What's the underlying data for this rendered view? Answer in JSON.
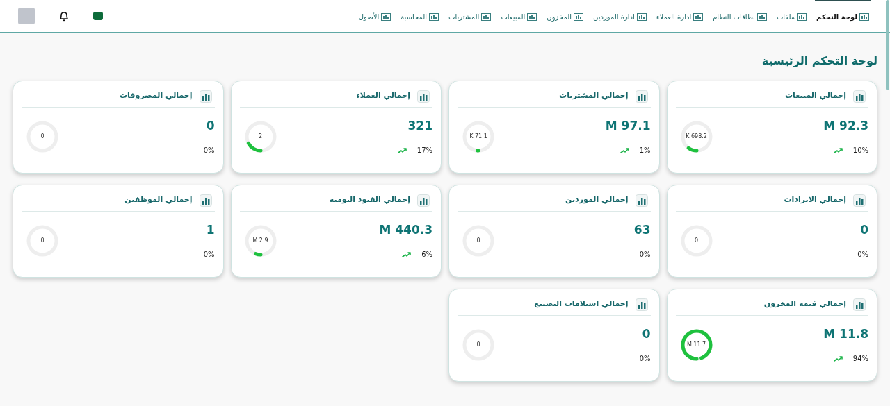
{
  "header": {
    "nav_items": [
      {
        "label": "لوحة التحكم",
        "selected": true
      },
      {
        "label": "ملفات",
        "selected": false
      },
      {
        "label": "بطاقات النظام",
        "selected": false
      },
      {
        "label": "ادارة العملاء",
        "selected": false
      },
      {
        "label": "ادارة الموردين",
        "selected": false
      },
      {
        "label": "المخزون",
        "selected": false
      },
      {
        "label": "المبيعات",
        "selected": false
      },
      {
        "label": "المشتريات",
        "selected": false
      },
      {
        "label": "المحاسبة",
        "selected": false
      },
      {
        "label": "الأصول",
        "selected": false
      }
    ]
  },
  "page_title": "لوحة التحكم الرئيسية",
  "cards": [
    {
      "title": "إجمالي المبيعات",
      "value": "M 92.3",
      "gauge_label": "K 698.2",
      "percent": "10%",
      "trend": true
    },
    {
      "title": "إجمالي المشتريات",
      "value": "M 97.1",
      "gauge_label": "K 71.1",
      "percent": "1%",
      "trend": true
    },
    {
      "title": "إجمالي العملاء",
      "value": "321",
      "gauge_label": "2",
      "percent": "17%",
      "trend": true
    },
    {
      "title": "إجمالي المصروفات",
      "value": "0",
      "gauge_label": "0",
      "percent": "0%",
      "trend": false
    },
    {
      "title": "إجمالي الايرادات",
      "value": "0",
      "gauge_label": "0",
      "percent": "0%",
      "trend": false
    },
    {
      "title": "إجمالي الموردين",
      "value": "63",
      "gauge_label": "0",
      "percent": "0%",
      "trend": false
    },
    {
      "title": "إجمالي القيود اليوميه",
      "value": "M 440.3",
      "gauge_label": "M 2.9",
      "percent": "6%",
      "trend": true
    },
    {
      "title": "إجمالي الموظفين",
      "value": "1",
      "gauge_label": "0",
      "percent": "0%",
      "trend": false
    },
    {
      "title": "إجمالي قيمه المخزون",
      "value": "M 11.8",
      "gauge_label": "M 11.7",
      "percent": "94%",
      "trend": true
    },
    {
      "title": "إجمالي استلامات التصنيع",
      "value": "0",
      "gauge_label": "0",
      "percent": "0%",
      "trend": false
    }
  ]
}
